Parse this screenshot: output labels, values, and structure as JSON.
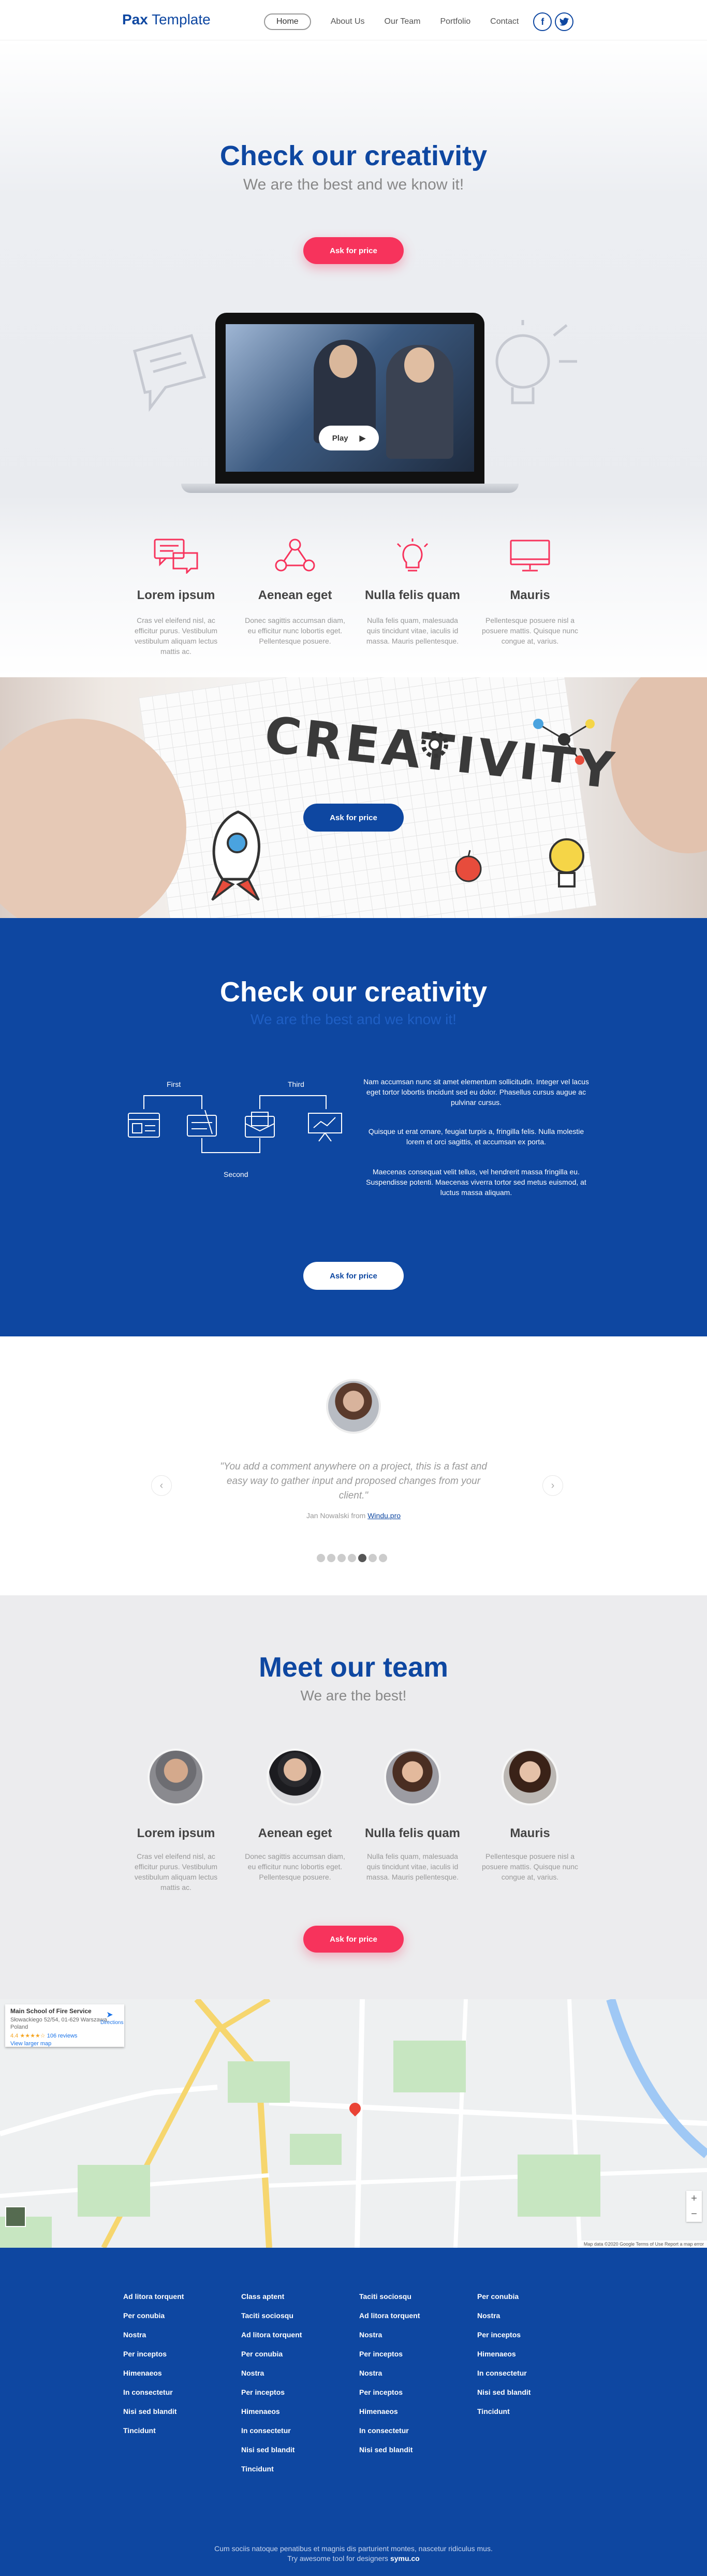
{
  "nav": {
    "brand_bold": "Pax",
    "brand_rest": "Template",
    "items": [
      "Home",
      "About Us",
      "Our Team",
      "Portfolio",
      "Contact"
    ],
    "active": "Home",
    "social": [
      "f",
      "twitter"
    ]
  },
  "hero": {
    "title": "Check our creativity",
    "subtitle": "We are the best and we know it!",
    "cta": "Ask for price",
    "play": "Play",
    "features": [
      {
        "icon": "chat-bubbles-icon",
        "title": "Lorem ipsum",
        "text": "Cras vel eleifend nisl, ac efficitur purus. Vestibulum vestibulum aliquam lectus mattis ac."
      },
      {
        "icon": "share-nodes-icon",
        "title": "Aenean eget",
        "text": "Donec sagittis accumsan diam, eu efficitur nunc lobortis eget. Pellentesque posuere."
      },
      {
        "icon": "lightbulb-icon",
        "title": "Nulla felis quam",
        "text": "Nulla felis quam, malesuada quis tincidunt vitae, iaculis id massa. Mauris pellentesque."
      },
      {
        "icon": "monitor-icon",
        "title": "Mauris",
        "text": "Pellentesque posuere nisl a posuere mattis. Quisque nunc congue at, varius."
      }
    ]
  },
  "banner": {
    "cta": "Ask for price"
  },
  "process": {
    "title": "Check our creativity",
    "subtitle": "We are the best and we know it!",
    "labels": {
      "first": "First",
      "second": "Second",
      "third": "Third"
    },
    "paragraphs": [
      "Nam accumsan nunc sit amet elementum sollicitudin. Integer vel lacus eget tortor lobortis tincidunt sed eu dolor. Phasellus cursus augue ac pulvinar cursus.",
      "Quisque ut erat ornare, feugiat turpis a, fringilla felis. Nulla molestie lorem et orci sagittis, et accumsan ex porta.",
      "Maecenas consequat velit tellus, vel hendrerit massa fringilla eu. Suspendisse potenti. Maecenas viverra tortor sed metus euismod, at luctus massa aliquam."
    ],
    "cta": "Ask for price"
  },
  "testimonial": {
    "quote": "\"You add a comment anywhere on a project, this is a fast and easy way to gather input and proposed changes from your client.\"",
    "author": "Jan Nowalski from",
    "company": "Windu.pro",
    "dots": 7,
    "active_dot": 5
  },
  "team": {
    "title": "Meet our team",
    "subtitle": "We are the best!",
    "members": [
      {
        "name": "Lorem ipsum",
        "text": "Cras vel eleifend nisl, ac efficitur purus. Vestibulum vestibulum aliquam lectus mattis ac."
      },
      {
        "name": "Aenean eget",
        "text": "Donec sagittis accumsan diam, eu efficitur nunc lobortis eget. Pellentesque posuere."
      },
      {
        "name": "Nulla felis quam",
        "text": "Nulla felis quam, malesuada quis tincidunt vitae, iaculis id massa. Mauris pellentesque."
      },
      {
        "name": "Mauris",
        "text": "Pellentesque posuere nisl a posuere mattis. Quisque nunc congue at, varius."
      }
    ],
    "cta": "Ask for price"
  },
  "map": {
    "place": "Main School of Fire Service",
    "address": "Słowackiego 52/54, 01-629 Warszawa, Poland",
    "rating": "4.4 ★★★★☆",
    "reviews": "106 reviews",
    "link": "View larger map",
    "directions": "Directions",
    "footer": "Map data ©2020 Google   Terms of Use   Report a map error"
  },
  "footer": {
    "columns": [
      [
        "Ad litora torquent",
        "Per conubia",
        "Nostra",
        "Per inceptos",
        "Himenaeos",
        "In consectetur",
        "Nisi sed blandit",
        "Tincidunt"
      ],
      [
        "Class aptent",
        "Taciti sociosqu",
        "Ad litora torquent",
        "Per conubia",
        "Nostra",
        "Per inceptos",
        "Himenaeos",
        "In consectetur",
        "Nisi sed blandit",
        "Tincidunt"
      ],
      [
        "Taciti sociosqu",
        "Ad litora torquent",
        "Nostra",
        "Per inceptos",
        "Nostra",
        "Per inceptos",
        "Himenaeos",
        "In consectetur",
        "Nisi sed blandit"
      ],
      [
        "Per conubia",
        "Nostra",
        "Per inceptos",
        "Himenaeos",
        "In consectetur",
        "Nisi sed blandit",
        "Tincidunt"
      ]
    ],
    "copy_line1": "Cum sociis natoque penatibus et magnis dis parturient montes, nascetur ridiculus mus.",
    "copy_line2": "Try awesome tool for designers",
    "copy_brand": "symu.co"
  },
  "colors": {
    "brand_blue": "#0e47a1",
    "accent_pink": "#f7335c"
  }
}
